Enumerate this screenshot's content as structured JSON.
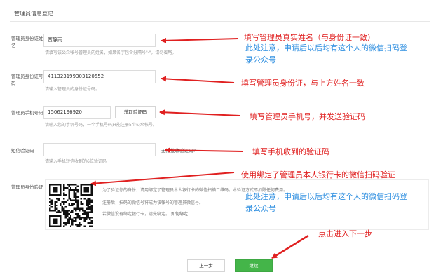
{
  "section_title": "管理员信息登记",
  "form": {
    "name": {
      "label": "管理员身份证姓名",
      "value": "贾静雨",
      "hint": "请填写该公众帐号管理员的姓名，如果名字包含分隔号\"·\"，请勿省略。"
    },
    "id_number": {
      "label": "管理员身份证号码",
      "value": "411323199303120552",
      "hint": "请输入管理员的身份证号码。"
    },
    "phone": {
      "label": "管理员手机号码",
      "value": "15062196920",
      "send_code_label": "获取验证码",
      "hint": "请输入您的手机号码，一个手机号码只能注册5个公众帐号。"
    },
    "sms_code": {
      "label": "短信验证码",
      "value": "",
      "no_code_link": "无法接收验证码?",
      "hint": "请输入手机短信收到的6位验证码"
    },
    "wechat_verify": {
      "label": "管理员身份验证",
      "line1": "为了验证你的身份，请用绑定了管理员本人银行卡的微信扫描二维码。本验证方式不扣除任何费用。",
      "line2": "注册后，扫码的微信号将成为该帐号的管理员微信号。",
      "line3": "若微信没有绑定银行卡，请先绑定。",
      "line3_link": "如何绑定"
    }
  },
  "buttons": {
    "prev": "上一步",
    "next": "继续"
  },
  "annotations": {
    "name_red": "填写管理员真实姓名（与身份证一致）",
    "name_blue_1": "此处注意，申请后以后均有这个人的微信扫码登",
    "name_blue_2": "录公众号",
    "id_red": "填写管理员身份证，与上方姓名一致",
    "phone_red": "填写管理员手机号，并发送验证码",
    "code_red": "填写手机收到的验证码",
    "scan_red": "使用绑定了管理员本人银行卡的微信扫码验证",
    "scan_blue_1": "此处注意，申请后以后均有这个人的微信扫码登",
    "scan_blue_2": "录公众号",
    "next_red": "点击进入下一步"
  },
  "colors": {
    "annotation_red": "#e02020",
    "annotation_blue": "#2f8fe0",
    "primary_green": "#44b549"
  }
}
